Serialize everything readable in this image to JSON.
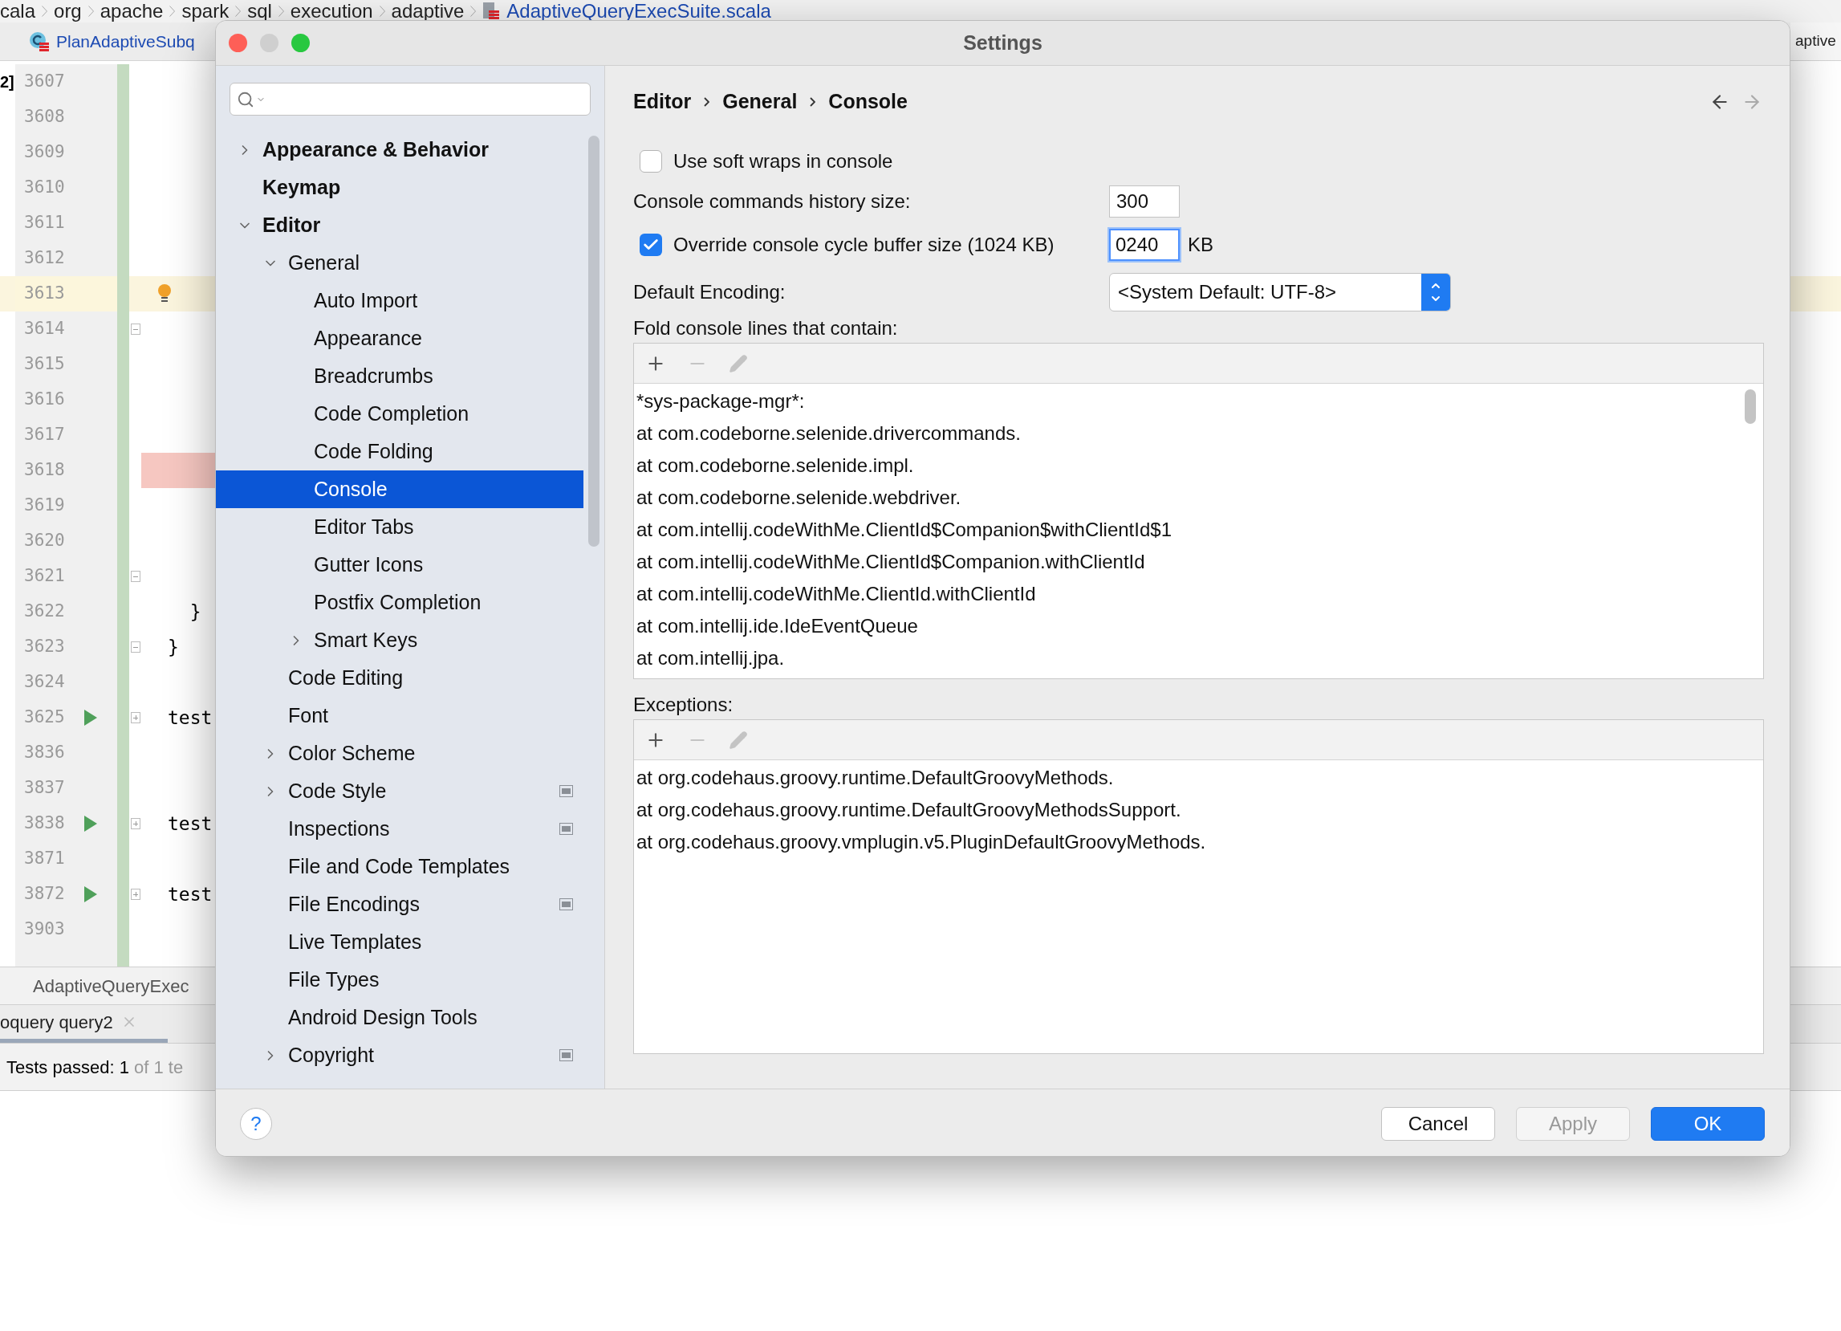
{
  "ide": {
    "path": [
      "cala",
      "org",
      "apache",
      "spark",
      "sql",
      "execution",
      "adaptive"
    ],
    "file": "AdaptiveQueryExecSuite.scala",
    "tabs": {
      "left": "PlanAdaptiveSubq",
      "right": "aptive"
    },
    "gutter_mark": "2]",
    "lines": [
      {
        "number": "3607",
        "kind": "plain"
      },
      {
        "number": "3608",
        "kind": "plain"
      },
      {
        "number": "3609",
        "kind": "plain"
      },
      {
        "number": "3610",
        "kind": "plain"
      },
      {
        "number": "3611",
        "kind": "plain"
      },
      {
        "number": "3612",
        "kind": "plain"
      },
      {
        "number": "3613",
        "kind": "current"
      },
      {
        "number": "3614",
        "kind": "fold"
      },
      {
        "number": "3615",
        "kind": "plain"
      },
      {
        "number": "3616",
        "kind": "plain"
      },
      {
        "number": "3617",
        "kind": "plain"
      },
      {
        "number": "3618",
        "kind": "error"
      },
      {
        "number": "3619",
        "kind": "plain"
      },
      {
        "number": "3620",
        "kind": "plain"
      },
      {
        "number": "3621",
        "kind": "fold"
      },
      {
        "number": "3622",
        "kind": "plain",
        "code": "  }"
      },
      {
        "number": "3623",
        "kind": "fold",
        "code": "}"
      },
      {
        "number": "3624",
        "kind": "plain"
      },
      {
        "number": "3625",
        "kind": "test",
        "code": "test"
      },
      {
        "number": "3836",
        "kind": "plain"
      },
      {
        "number": "3837",
        "kind": "plain"
      },
      {
        "number": "3838",
        "kind": "test",
        "code": "test"
      },
      {
        "number": "3871",
        "kind": "plain"
      },
      {
        "number": "3872",
        "kind": "test",
        "code": "test"
      },
      {
        "number": "3903",
        "kind": "plain"
      }
    ],
    "file_tab": "AdaptiveQueryExec",
    "run_tab": {
      "label": "oquery query2",
      "selected": true
    },
    "status": {
      "text": "Tests passed: 1",
      "detail": "of 1 te"
    }
  },
  "dialog": {
    "title": "Settings",
    "window_buttons": [
      {
        "kind": "close",
        "disabled": false
      },
      {
        "kind": "minimize",
        "disabled": true
      },
      {
        "kind": "zoom",
        "disabled": false
      }
    ],
    "tree": [
      {
        "label": "Appearance & Behavior",
        "kind": "group",
        "expanded": false,
        "selected": false,
        "project": false
      },
      {
        "label": "Keymap",
        "kind": "page",
        "selected": false,
        "project": false
      },
      {
        "label": "Editor",
        "kind": "group",
        "expanded": true,
        "selected": false,
        "project": false,
        "children": [
          {
            "label": "General",
            "kind": "group",
            "expanded": true,
            "selected": false,
            "project": false,
            "children": [
              {
                "label": "Auto Import",
                "kind": "page",
                "selected": false,
                "project": false
              },
              {
                "label": "Appearance",
                "kind": "page",
                "selected": false,
                "project": false
              },
              {
                "label": "Breadcrumbs",
                "kind": "page",
                "selected": false,
                "project": false
              },
              {
                "label": "Code Completion",
                "kind": "page",
                "selected": false,
                "project": false
              },
              {
                "label": "Code Folding",
                "kind": "page",
                "selected": false,
                "project": false
              },
              {
                "label": "Console",
                "kind": "page",
                "selected": true,
                "project": false
              },
              {
                "label": "Editor Tabs",
                "kind": "page",
                "selected": false,
                "project": false
              },
              {
                "label": "Gutter Icons",
                "kind": "page",
                "selected": false,
                "project": false
              },
              {
                "label": "Postfix Completion",
                "kind": "page",
                "selected": false,
                "project": false
              },
              {
                "label": "Smart Keys",
                "kind": "group",
                "expanded": false,
                "selected": false,
                "project": false
              }
            ]
          },
          {
            "label": "Code Editing",
            "kind": "page",
            "selected": false,
            "project": false
          },
          {
            "label": "Font",
            "kind": "page",
            "selected": false,
            "project": false
          },
          {
            "label": "Color Scheme",
            "kind": "group",
            "expanded": false,
            "selected": false,
            "project": false
          },
          {
            "label": "Code Style",
            "kind": "group",
            "expanded": false,
            "selected": false,
            "project": true
          },
          {
            "label": "Inspections",
            "kind": "page",
            "selected": false,
            "project": true
          },
          {
            "label": "File and Code Templates",
            "kind": "page",
            "selected": false,
            "project": false
          },
          {
            "label": "File Encodings",
            "kind": "page",
            "selected": false,
            "project": true
          },
          {
            "label": "Live Templates",
            "kind": "page",
            "selected": false,
            "project": false
          },
          {
            "label": "File Types",
            "kind": "page",
            "selected": false,
            "project": false
          },
          {
            "label": "Android Design Tools",
            "kind": "page",
            "selected": false,
            "project": false
          },
          {
            "label": "Copyright",
            "kind": "group",
            "expanded": false,
            "selected": false,
            "project": true
          }
        ]
      }
    ],
    "breadcrumb": [
      "Editor",
      "General",
      "Console"
    ],
    "nav": [
      {
        "kind": "back",
        "disabled": false
      },
      {
        "kind": "forward",
        "disabled": true
      }
    ],
    "soft_wraps": {
      "label": "Use soft wraps in console",
      "checked": false
    },
    "history": {
      "label": "Console commands history size:",
      "value": "300",
      "focused": false
    },
    "cycle_buffer": {
      "label": "Override console cycle buffer size (1024 KB)",
      "checked": true,
      "value": "0240",
      "unit": "KB",
      "focused": true
    },
    "encoding": {
      "label": "Default Encoding:",
      "value": "<System Default: UTF-8>"
    },
    "lists": [
      {
        "label": "Fold console lines that contain:",
        "scrollbar": true,
        "tools": [
          {
            "kind": "add",
            "disabled": false
          },
          {
            "kind": "remove",
            "disabled": true
          },
          {
            "kind": "edit",
            "disabled": true
          }
        ],
        "items": [
          "*sys-package-mgr*:",
          "at com.codeborne.selenide.drivercommands.",
          "at com.codeborne.selenide.impl.",
          "at com.codeborne.selenide.webdriver.",
          "at com.intellij.codeWithMe.ClientId$Companion$withClientId$1",
          "at com.intellij.codeWithMe.ClientId$Companion.withClientId",
          "at com.intellij.codeWithMe.ClientId.withClientId",
          "at com.intellij.ide.IdeEventQueue",
          "at com.intellij.jpa."
        ]
      },
      {
        "label": "Exceptions:",
        "scrollbar": false,
        "tools": [
          {
            "kind": "add",
            "disabled": false
          },
          {
            "kind": "remove",
            "disabled": true
          },
          {
            "kind": "edit",
            "disabled": true
          }
        ],
        "items": [
          "at org.codehaus.groovy.runtime.DefaultGroovyMethods.",
          "at org.codehaus.groovy.runtime.DefaultGroovyMethodsSupport.",
          "at org.codehaus.groovy.vmplugin.v5.PluginDefaultGroovyMethods."
        ]
      }
    ],
    "help": "?",
    "buttons": [
      {
        "label": "Cancel",
        "kind": "default",
        "disabled": false
      },
      {
        "label": "Apply",
        "kind": "default",
        "disabled": true
      },
      {
        "label": "OK",
        "kind": "primary",
        "disabled": false
      }
    ]
  }
}
